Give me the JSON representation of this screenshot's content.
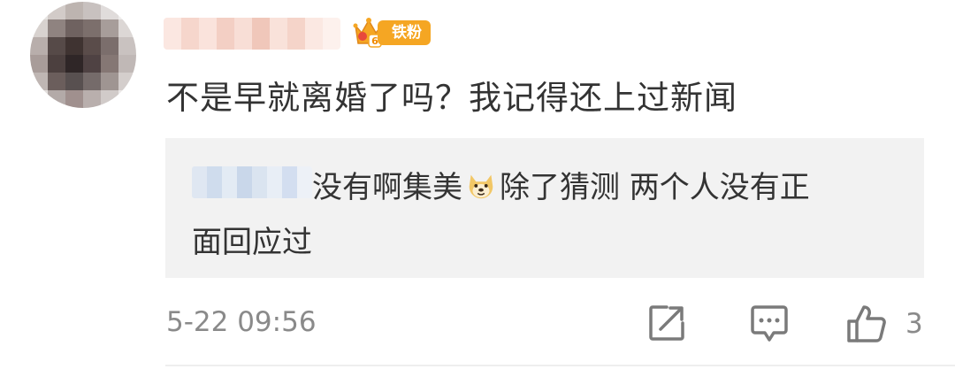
{
  "comment": {
    "badge_label": "铁粉",
    "badge_level": "6",
    "text": "不是早就离婚了吗？我记得还上过新闻",
    "time": "5-22 09:56",
    "like_count": "3",
    "icons": {
      "share": "share-edit-icon",
      "reply": "comment-bubble-icon",
      "like": "thumb-up-icon",
      "crown": "crown-icon",
      "emoji": "doge-emoji-icon"
    }
  },
  "reply": {
    "line1": [
      "没有啊集美",
      "除了猜测 两个人没有正"
    ],
    "line2": "面回应过"
  },
  "colors": {
    "badge": "#f5a623",
    "reply_background": "#f2f2f2",
    "meta_text": "#8a8a8a",
    "icon": "#7a7a7a"
  }
}
